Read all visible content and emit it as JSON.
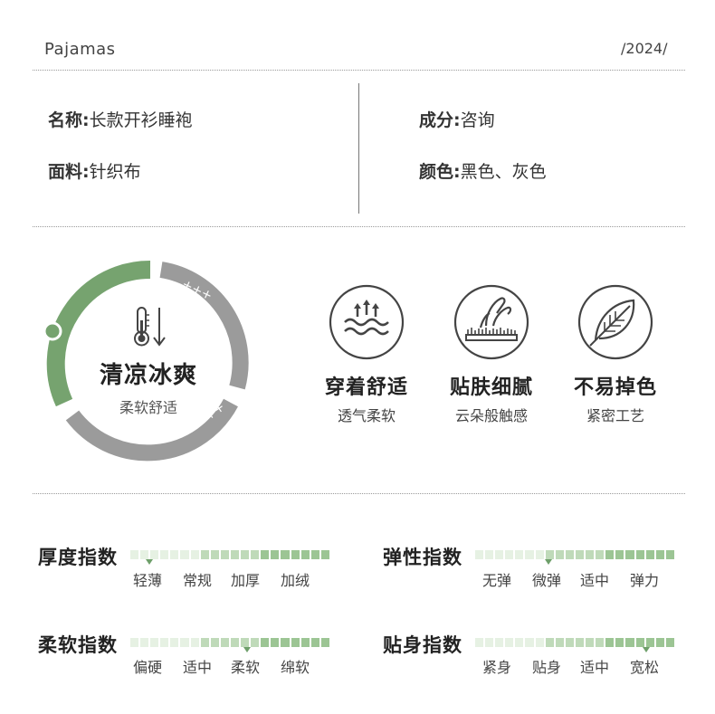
{
  "header": {
    "brand": "Pajamas",
    "year": "/2024/"
  },
  "info": {
    "name_label": "名称:",
    "name_value": "长款开衫睡袍",
    "fabric_label": "面料:",
    "fabric_value": "针织布",
    "composition_label": "成分:",
    "composition_value": "咨询",
    "color_label": "颜色:",
    "color_value": "黑色、灰色"
  },
  "ring": {
    "title": "清凉冰爽",
    "subtitle": "柔软舒适",
    "plus_top": "+++",
    "plus_bottom": "++",
    "green": "#76a36f",
    "gray": "#9b9b9b",
    "icon": "thermometer-down-icon"
  },
  "features": [
    {
      "title": "穿着舒适",
      "subtitle": "透气柔软",
      "icon": "breathable-waves-icon"
    },
    {
      "title": "贴肤细腻",
      "subtitle": "云朵般触感",
      "icon": "hand-touch-icon"
    },
    {
      "title": "不易掉色",
      "subtitle": "紧密工艺",
      "icon": "leaf-icon"
    }
  ],
  "indices": [
    {
      "title": "厚度指数",
      "levels": [
        "轻薄",
        "常规",
        "加厚",
        "加绒"
      ],
      "selected": 0
    },
    {
      "title": "弹性指数",
      "levels": [
        "无弹",
        "微弹",
        "适中",
        "弹力"
      ],
      "selected": 1
    },
    {
      "title": "柔软指数",
      "levels": [
        "偏硬",
        "适中",
        "柔软",
        "绵软"
      ],
      "selected": 2
    },
    {
      "title": "贴身指数",
      "levels": [
        "紧身",
        "贴身",
        "适中",
        "宽松"
      ],
      "selected": 3
    }
  ],
  "colors": {
    "bar_light": "#e6f1e3",
    "bar_mid": "#bfdab9",
    "bar_dark": "#9cc594",
    "marker": "#6e9f6a"
  }
}
